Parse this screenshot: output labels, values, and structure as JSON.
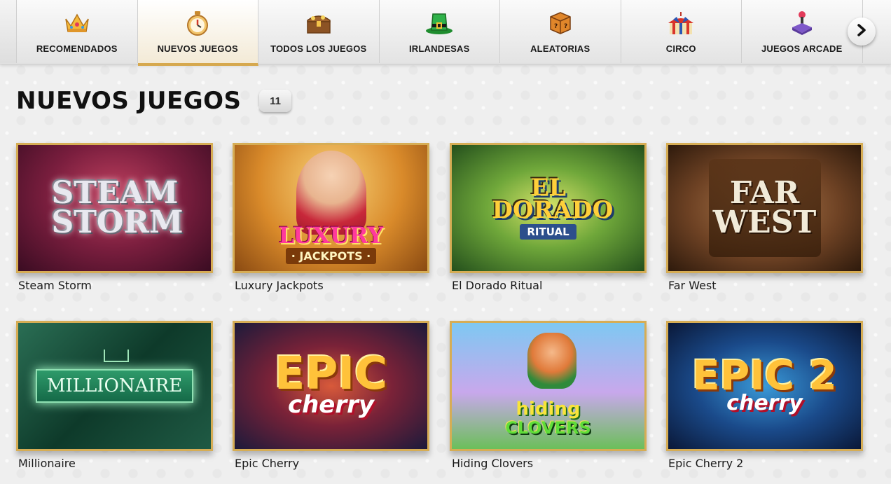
{
  "nav": {
    "tabs": [
      {
        "label": "RECOMENDADOS",
        "icon": "crown-icon",
        "active": false
      },
      {
        "label": "NUEVOS JUEGOS",
        "icon": "stopwatch-icon",
        "active": true
      },
      {
        "label": "TODOS LOS JUEGOS",
        "icon": "treasure-chest-icon",
        "active": false
      },
      {
        "label": "IRLANDESAS",
        "icon": "leprechaun-hat-icon",
        "active": false
      },
      {
        "label": "ALEATORIAS",
        "icon": "mystery-box-icon",
        "active": false
      },
      {
        "label": "CIRCO",
        "icon": "circus-tent-icon",
        "active": false
      },
      {
        "label": "JUEGOS ARCADE",
        "icon": "joystick-icon",
        "active": false
      }
    ],
    "next_icon": "chevron-right-icon"
  },
  "section": {
    "title": "NUEVOS JUEGOS",
    "count": "11"
  },
  "games": [
    {
      "name": "Steam Storm",
      "art_title": "STEAM STORM",
      "art_sub": ""
    },
    {
      "name": "Luxury Jackpots",
      "art_title": "LUXURY",
      "art_sub": "· JACKPOTS ·"
    },
    {
      "name": "El Dorado Ritual",
      "art_title": "EL DORADO",
      "art_sub": "RITUAL"
    },
    {
      "name": "Far West",
      "art_title": "FAR WEST",
      "art_sub": ""
    },
    {
      "name": "Millionaire",
      "art_title": "MILLIONAIRE",
      "art_sub": ""
    },
    {
      "name": "Epic Cherry",
      "art_title": "EPIC",
      "art_sub": "cherry"
    },
    {
      "name": "Hiding Clovers",
      "art_title": "hiding",
      "art_sub": "CLOVERS"
    },
    {
      "name": "Epic Cherry 2",
      "art_title": "EPIC 2",
      "art_sub": "cherry"
    }
  ],
  "colors": {
    "accent_gold": "#d6ad55",
    "title_text": "#111111"
  }
}
